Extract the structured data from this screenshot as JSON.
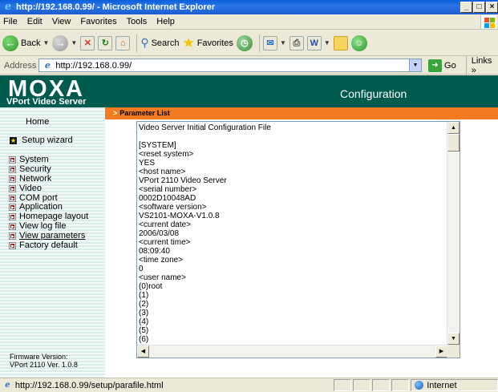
{
  "window": {
    "title": "http://192.168.0.99/ - Microsoft Internet Explorer",
    "min_label": "_",
    "max_label": "□",
    "close_label": "×"
  },
  "menubar": {
    "items": [
      "File",
      "Edit",
      "View",
      "Favorites",
      "Tools",
      "Help"
    ]
  },
  "toolbar": {
    "back_label": "Back",
    "search_label": "Search",
    "favorites_label": "Favorites"
  },
  "address": {
    "label": "Address",
    "url": "http://192.168.0.99/",
    "go_label": "Go",
    "links_label": "Links »"
  },
  "header": {
    "brand": "MOXA",
    "product": "VPort Video Server",
    "title": "Configuration"
  },
  "breadcrumb": {
    "marker": ">",
    "label": "Parameter List"
  },
  "sidebar": {
    "home": "Home",
    "setup_wizard": "Setup wizard",
    "items": [
      {
        "label": "System",
        "current": false
      },
      {
        "label": "Security",
        "current": false
      },
      {
        "label": "Network",
        "current": false
      },
      {
        "label": "Video",
        "current": false
      },
      {
        "label": "COM port",
        "current": false
      },
      {
        "label": "Application",
        "current": false
      },
      {
        "label": "Homepage layout",
        "current": false
      },
      {
        "label": "View log file",
        "current": false
      },
      {
        "label": "View parameters",
        "current": true
      },
      {
        "label": "Factory default",
        "current": false
      }
    ],
    "firmware_label": "Firmware Version:",
    "firmware_value": "VPort 2110 Ver. 1.0.8"
  },
  "parameters": {
    "lines": [
      "Video Server Initial Configuration File",
      "",
      "[SYSTEM]",
      "<reset system>",
      "YES",
      "<host name>",
      "VPort 2110 Video Server",
      "<serial number>",
      "0002D10048AD",
      "<software version>",
      "VS2101-MOXA-V1.0.8",
      "<current date>",
      "2006/03/08",
      "<current time>",
      "08:09:40",
      "<time zone>",
      "0",
      "<user name>",
      "(0)root",
      "(1)",
      "(2)",
      "(3)",
      "(4)",
      "(5)",
      "(6)"
    ]
  },
  "status": {
    "url": "http://192.168.0.99/setup/parafile.html",
    "zone": "Internet"
  }
}
